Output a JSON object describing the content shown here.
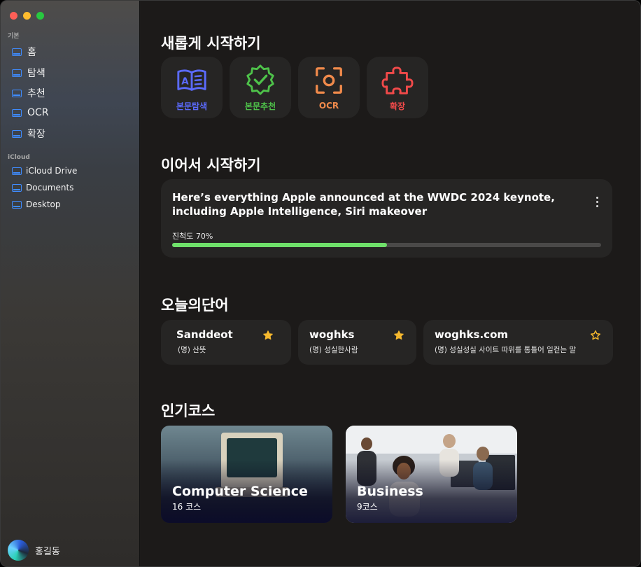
{
  "sidebar": {
    "section_basic": "기본",
    "basic_items": [
      {
        "label": "홈"
      },
      {
        "label": "탐색"
      },
      {
        "label": "추천"
      },
      {
        "label": "OCR"
      },
      {
        "label": "확장"
      }
    ],
    "section_icloud": "iCloud",
    "icloud_items": [
      {
        "label": "iCloud Drive"
      },
      {
        "label": "Documents"
      },
      {
        "label": "Desktop"
      }
    ],
    "user_name": "홍길동"
  },
  "main": {
    "start_title": "새롭게 시작하기",
    "quick_actions": [
      {
        "label": "본문탐색",
        "icon": "book-icon",
        "color": "#5b6bff"
      },
      {
        "label": "본문추천",
        "icon": "verified-badge-icon",
        "color": "#4ec24a"
      },
      {
        "label": "OCR",
        "icon": "scan-icon",
        "color": "#f08a4b"
      },
      {
        "label": "확장",
        "icon": "puzzle-icon",
        "color": "#f24a4a"
      }
    ],
    "continue_title": "이어서 시작하기",
    "continue_card": {
      "title": "Here’s everything Apple announced at the WWDC 2024 keynote, including Apple Intelligence, Siri makeover",
      "progress_label": "진척도 70%",
      "progress": 0.5,
      "progress_color": "#6fe06a"
    },
    "words_title": "오늘의단어",
    "words": [
      {
        "word": "Sanddeot",
        "definition": "(명) 산뜻",
        "starred": true
      },
      {
        "word": "woghks",
        "definition": "(명) 성실한사람",
        "starred": true
      },
      {
        "word": "woghks.com",
        "definition": "(명) 성실성실 사이트 따위를 통틀어 일컫는 말",
        "starred": false
      }
    ],
    "star_color": "#f5b82e",
    "courses_title": "인기코스",
    "courses": [
      {
        "title": "Computer Science",
        "count": "16 코스"
      },
      {
        "title": "Business",
        "count": "9코스"
      }
    ]
  }
}
